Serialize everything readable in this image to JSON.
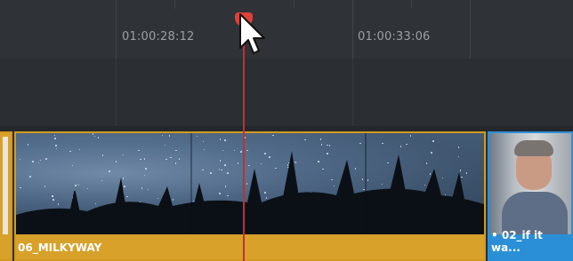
{
  "ruler": {
    "timecodes": [
      "01:00:28:12",
      "01:00:33:06"
    ]
  },
  "clips": {
    "current": {
      "name": "06_MILKYWAY",
      "color": "#d7a12a"
    },
    "next": {
      "name": "• 02_if it wa...",
      "color": "#2a8fd6"
    }
  },
  "playhead": {
    "color": "#e0403a"
  },
  "icons": {
    "cursor": "arrow-pointer-icon"
  }
}
